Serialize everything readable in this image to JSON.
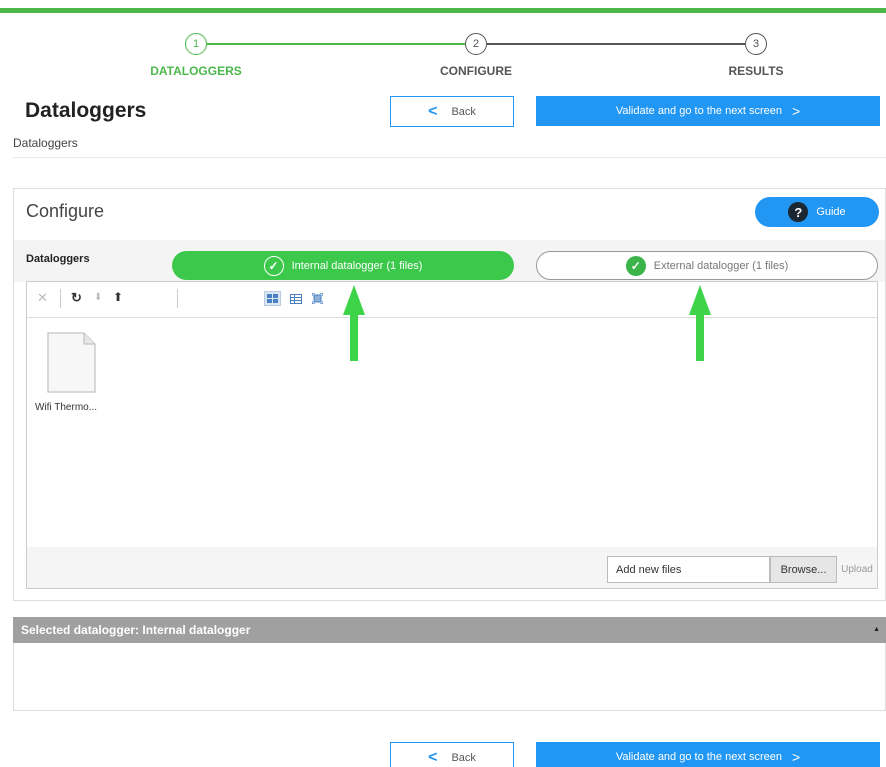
{
  "colors": {
    "accent_green": "#4cb84c",
    "primary_blue": "#2196f3",
    "arrow_green": "#3dd44a"
  },
  "stepper": {
    "steps": [
      {
        "number": "1",
        "label": "DATALOGGERS"
      },
      {
        "number": "2",
        "label": "CONFIGURE"
      },
      {
        "number": "3",
        "label": "RESULTS"
      }
    ]
  },
  "header": {
    "title": "Dataloggers",
    "breadcrumb": "Dataloggers",
    "back_label": "Back",
    "next_label": "Validate and go to the next screen",
    "back_chevron": "<",
    "next_chevron": ">"
  },
  "configure": {
    "title": "Configure",
    "guide_icon_glyph": "?",
    "guide_label": "Guide",
    "dataloggers_label": "Dataloggers",
    "tabs": [
      {
        "label": "Internal datalogger (1 files)",
        "check": "✓"
      },
      {
        "label": "External datalogger (1 files)",
        "check": "✓"
      }
    ],
    "toolbar": {
      "delete_glyph": "✕",
      "refresh_glyph": "↻",
      "download_glyph": "⬇",
      "upload_glyph": "⬆"
    },
    "files": [
      {
        "name": "Wifi Thermo..."
      }
    ],
    "add_files_value": "Add new files",
    "browse_label": "Browse...",
    "upload_label": "Upload"
  },
  "selected": {
    "title": "Selected datalogger: Internal datalogger",
    "caret": "▲"
  },
  "footer": {
    "back_label": "Back",
    "next_label": "Validate and go to the next screen",
    "back_chevron": "<",
    "next_chevron": ">"
  }
}
